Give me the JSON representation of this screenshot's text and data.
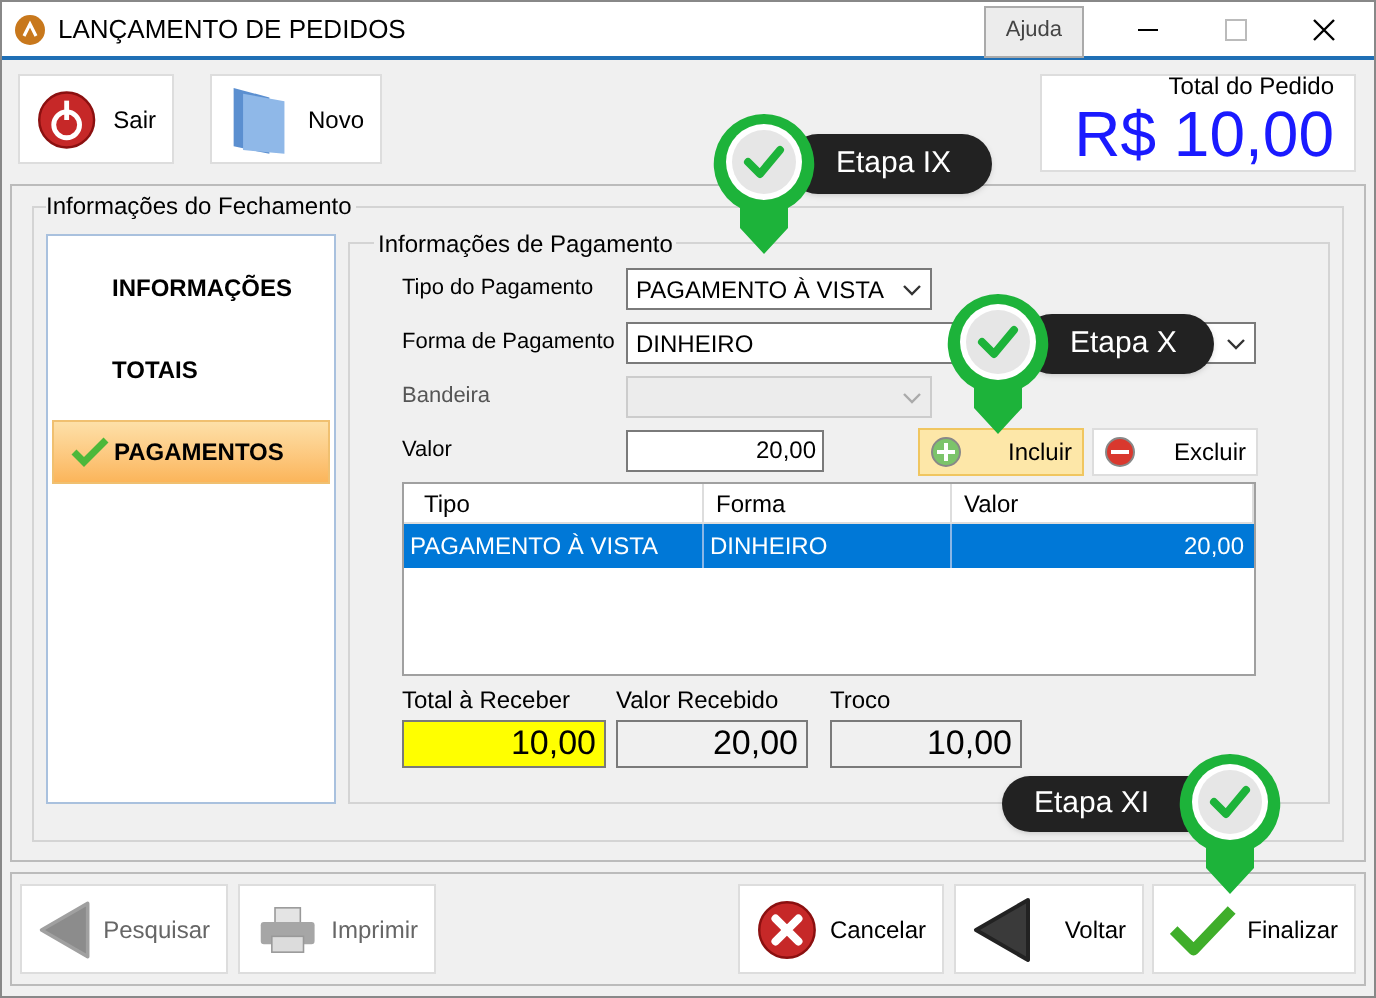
{
  "window": {
    "title": "LANÇAMENTO DE PEDIDOS",
    "help_button": "Ajuda"
  },
  "toolbar": [
    {
      "label": "Sair",
      "kind": "power"
    },
    {
      "label": "Novo",
      "kind": "folder"
    }
  ],
  "order_total": {
    "caption": "Total do Pedido",
    "value": "R$ 10,00"
  },
  "closing": {
    "title": "Informações do Fechamento",
    "sidebar": [
      {
        "label": "INFORMAÇÕES",
        "selected": false
      },
      {
        "label": "TOTAIS",
        "selected": false
      },
      {
        "label": "PAGAMENTOS",
        "selected": true
      }
    ],
    "payment": {
      "title": "Informações de Pagamento",
      "fields": [
        {
          "label": "Tipo do Pagamento",
          "value": "PAGAMENTO À VISTA",
          "kind": "select",
          "disabled": false
        },
        {
          "label": "Forma de Pagamento",
          "value": "DINHEIRO",
          "kind": "select",
          "disabled": false
        },
        {
          "label": "Bandeira",
          "kind": "select",
          "disabled": true
        },
        {
          "label": "Valor",
          "value": "20,00",
          "kind": "input"
        }
      ],
      "actions": [
        {
          "label": "Incluir",
          "kind": "add",
          "highlighted": true
        },
        {
          "label": "Excluir",
          "kind": "remove",
          "highlighted": false
        }
      ],
      "table": {
        "columns": [
          "Tipo",
          "Forma",
          "Valor"
        ],
        "rows": [
          {
            "cells": [
              "PAGAMENTO À VISTA",
              "DINHEIRO",
              "20,00"
            ],
            "selected": true
          }
        ]
      },
      "totals": [
        {
          "label": "Total à Receber",
          "value": "10,00",
          "highlighted": true
        },
        {
          "label": "Valor Recebido",
          "value": "20,00",
          "highlighted": false
        },
        {
          "label": "Troco",
          "value": "10,00",
          "highlighted": false
        }
      ]
    }
  },
  "footer_buttons": [
    {
      "label": "Pesquisar",
      "kind": "back",
      "disabled": true
    },
    {
      "label": "Imprimir",
      "kind": "print",
      "disabled": true
    },
    {
      "label": "Cancelar",
      "kind": "cancel",
      "disabled": false
    },
    {
      "label": "Voltar",
      "kind": "back",
      "disabled": false
    },
    {
      "label": "Finalizar",
      "kind": "check",
      "disabled": false
    }
  ],
  "callouts": [
    {
      "label": "Etapa IX"
    },
    {
      "label": "Etapa X"
    },
    {
      "label": "Etapa XI"
    }
  ]
}
